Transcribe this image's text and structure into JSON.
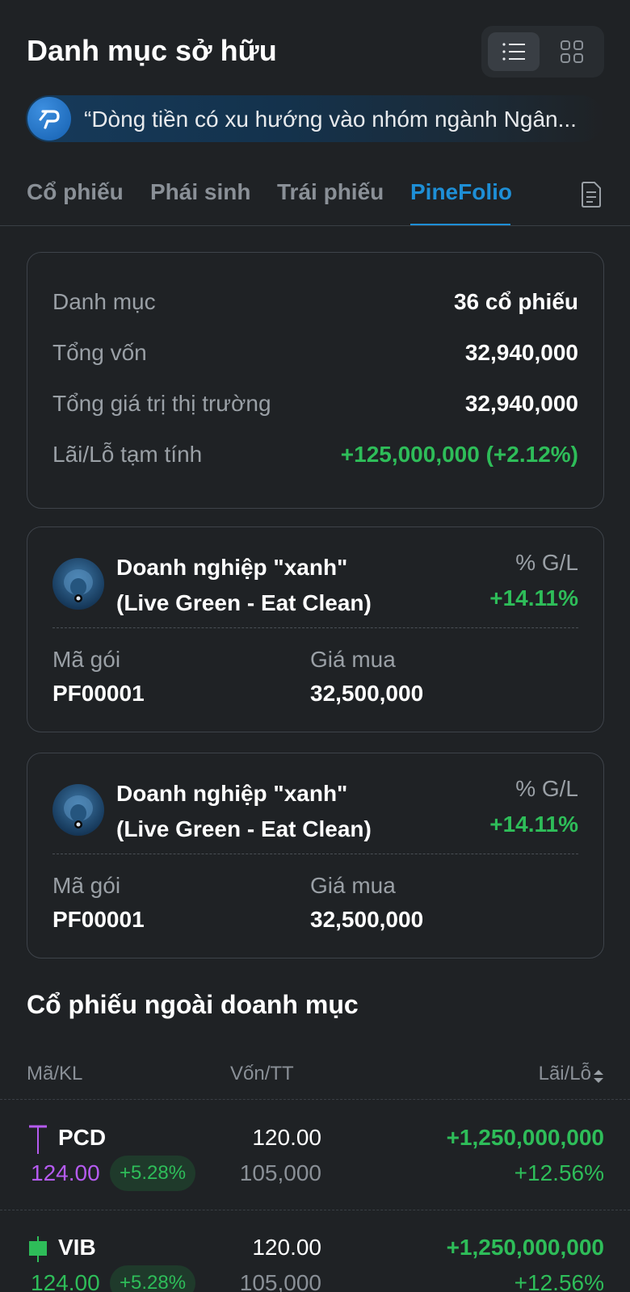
{
  "header": {
    "title": "Danh mục sở hữu"
  },
  "view_toggle": {
    "active": "list"
  },
  "ticker": {
    "text": "“Dòng tiền có xu hướng vào nhóm ngành Ngân..."
  },
  "tabs": [
    {
      "label": "Cổ phiếu",
      "active": false
    },
    {
      "label": "Phái sinh",
      "active": false
    },
    {
      "label": "Trái phiếu",
      "active": false
    },
    {
      "label": "PineFolio",
      "active": true
    }
  ],
  "summary": {
    "portfolio_label": "Danh mục",
    "portfolio_value": "36 cổ phiếu",
    "capital_label": "Tổng vốn",
    "capital_value": "32,940,000",
    "market_label": "Tổng giá trị thị trường",
    "market_value": "32,940,000",
    "pl_label": "Lãi/Lỗ tạm tính",
    "pl_value": "+125,000,000 (+2.12%)"
  },
  "pinefolios": [
    {
      "name_line1": "Doanh nghiệp \"xanh\"",
      "name_line2": "(Live Green - Eat Clean)",
      "gl_label": "% G/L",
      "gl_value": "+14.11%",
      "code_label": "Mã gói",
      "code": "PF00001",
      "price_label": "Giá mua",
      "price": "32,500,000"
    },
    {
      "name_line1": "Doanh nghiệp \"xanh\"",
      "name_line2": "(Live Green - Eat Clean)",
      "gl_label": "% G/L",
      "gl_value": "+14.11%",
      "code_label": "Mã gói",
      "code": "PF00001",
      "price_label": "Giá mua",
      "price": "32,500,000"
    }
  ],
  "outside": {
    "title": "Cổ phiếu ngoài doanh mục",
    "columns": {
      "symbol": "Mã/KL",
      "cost": "Vốn/TT",
      "pl": "Lãi/Lỗ"
    },
    "rows": [
      {
        "symbol": "PCD",
        "price": "124.00",
        "change": "+5.28%",
        "cost": "120.00",
        "market": "105,000",
        "pl": "+1,250,000,000",
        "pl_pct": "+12.56%",
        "price_color": "#b55bf0",
        "candle_color": "#b55bf0",
        "candle_type": "doji"
      },
      {
        "symbol": "VIB",
        "price": "124.00",
        "change": "+5.28%",
        "cost": "120.00",
        "market": "105,000",
        "pl": "+1,250,000,000",
        "pl_pct": "+12.56%",
        "price_color": "#2ebd59",
        "candle_color": "#2ebd59",
        "candle_type": "body"
      }
    ]
  },
  "colors": {
    "accent": "#1e8fd6",
    "positive": "#2ebd59",
    "ceiling": "#b55bf0",
    "background": "#1f2225"
  }
}
